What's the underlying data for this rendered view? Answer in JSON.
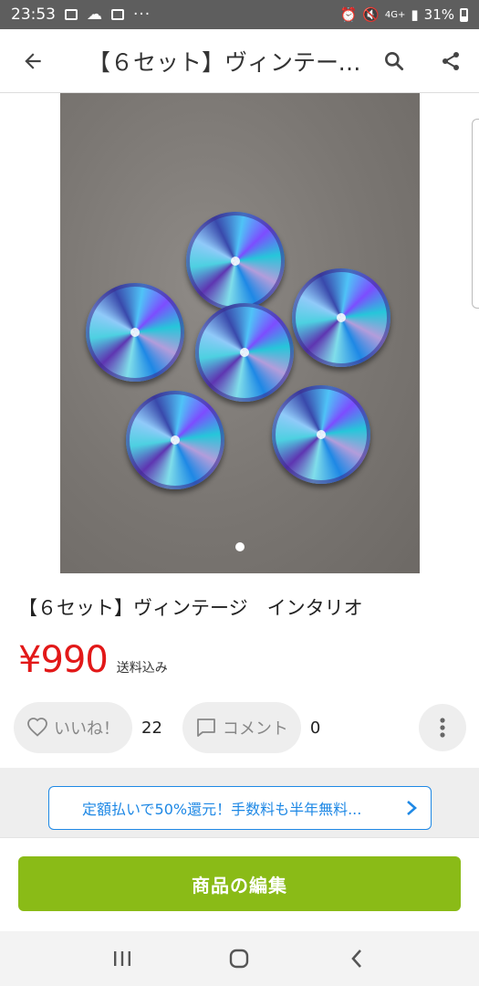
{
  "status_bar": {
    "time": "23:53",
    "left_icons": [
      "gallery-icon",
      "cloud-icon",
      "calendar-icon",
      "more-dots-icon"
    ],
    "battery": "31%",
    "network": "4G+"
  },
  "app_bar": {
    "title": "【６セット】ヴィンテージ　インタリオ",
    "icons": [
      "back-arrow-icon",
      "search-icon",
      "share-icon"
    ]
  },
  "gallery": {
    "page_count": 1,
    "current_page": 1,
    "item_count_in_photo": 6,
    "next_icon": "chevron-right-icon"
  },
  "item": {
    "title": "【６セット】ヴィンテージ　インタリオ",
    "price": "¥990",
    "shipping": "送料込み"
  },
  "actions": {
    "like_label": "いいね！",
    "like_count": "22",
    "comment_label": "コメント",
    "comment_count": "0"
  },
  "promo": {
    "text": "定額払いで50%還元！手数料も半年無料..."
  },
  "cta": {
    "label": "商品の編集"
  },
  "colors": {
    "price": "#e21818",
    "cta": "#8abb17",
    "promo": "#1e88e5"
  }
}
